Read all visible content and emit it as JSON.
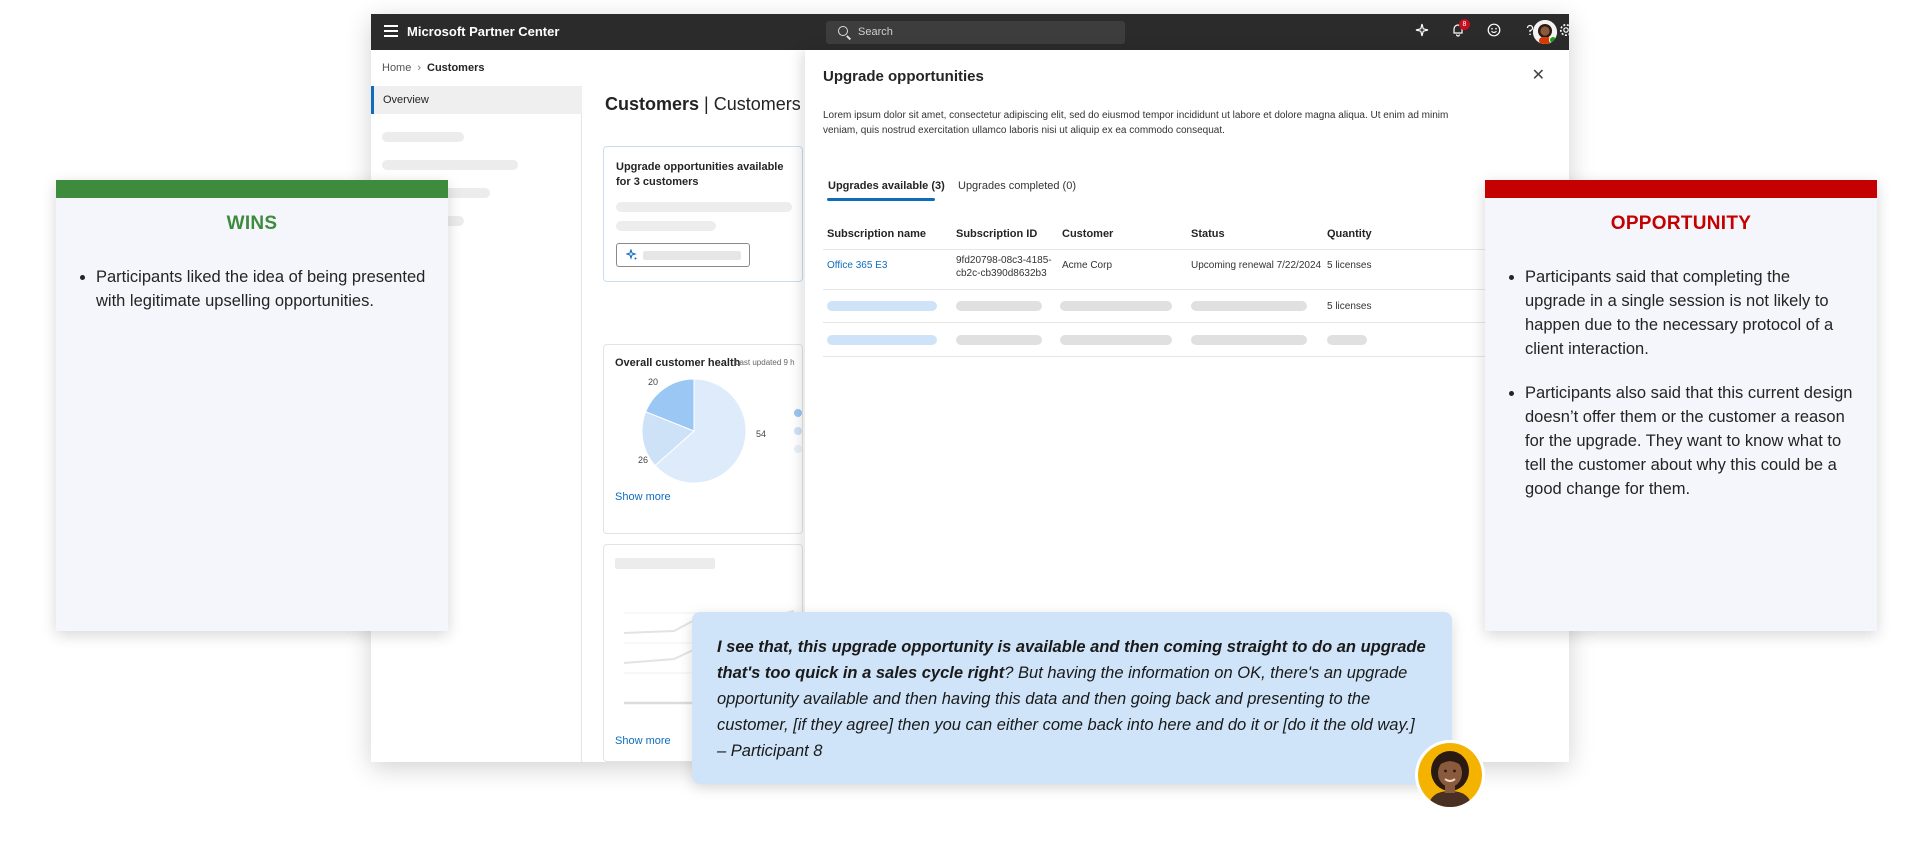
{
  "app": {
    "title": "Microsoft Partner Center",
    "search_placeholder": "Search",
    "notification_count": "8"
  },
  "breadcrumb": {
    "home": "Home",
    "current": "Customers"
  },
  "nav": {
    "overview": "Overview"
  },
  "page": {
    "title_bold": "Customers",
    "title_rest": " | Customers C"
  },
  "upgrade_card": {
    "title": "Upgrade opportunities available for 3 customers"
  },
  "health": {
    "title": "Overall customer health",
    "updated": "Last updated 9 h",
    "show_more": "Show more",
    "labels": [
      "20",
      "26",
      "54"
    ]
  },
  "trend": {
    "show_more": "Show more"
  },
  "panel": {
    "title": "Upgrade opportunities",
    "description": "Lorem ipsum dolor sit amet, consectetur adipiscing elit, sed do eiusmod tempor incididunt ut labore et dolore magna aliqua. Ut enim ad minim veniam, quis nostrud exercitation ullamco laboris nisi ut aliquip ex ea commodo consequat.",
    "tabs": [
      "Upgrades available (3)",
      "Upgrades completed (0)"
    ],
    "columns": [
      "Subscription name",
      "Subscription ID",
      "Customer",
      "Status",
      "Quantity"
    ],
    "row1": {
      "name": "Office 365 E3",
      "id_line1": "9fd20798-08c3-4185-",
      "id_line2": "cb2c-cb390d8632b3",
      "customer": "Acme Corp",
      "status": "Upcoming renewal 7/22/2024",
      "quantity": "5 licenses"
    },
    "row2": {
      "quantity": "5 licenses"
    }
  },
  "wins": {
    "heading": "WINS",
    "items": [
      "Participants liked the idea of being presented with legitimate upselling opportunities."
    ],
    "color": "#3e8b3e"
  },
  "opportunity": {
    "heading": "OPPORTUNITY",
    "items": [
      "Participants said that completing the upgrade in a single session is not likely to happen due to the necessary protocol of a client interaction.",
      "Participants also said that this current design doesn’t offer them or the customer a reason for the upgrade. They want to know what to tell the customer about why this could be a good change for them."
    ],
    "color": "#c50000"
  },
  "quote": {
    "bold": "I see that, this upgrade opportunity is available and then coming straight to do an upgrade that's too quick in a sales cycle right",
    "rest": "? But having the information on OK, there's an upgrade opportunity available and then having this data and then going back and presenting to the customer, [if they agree] then you can either come back into here and do it or [do it the old way.] – Participant 8"
  }
}
